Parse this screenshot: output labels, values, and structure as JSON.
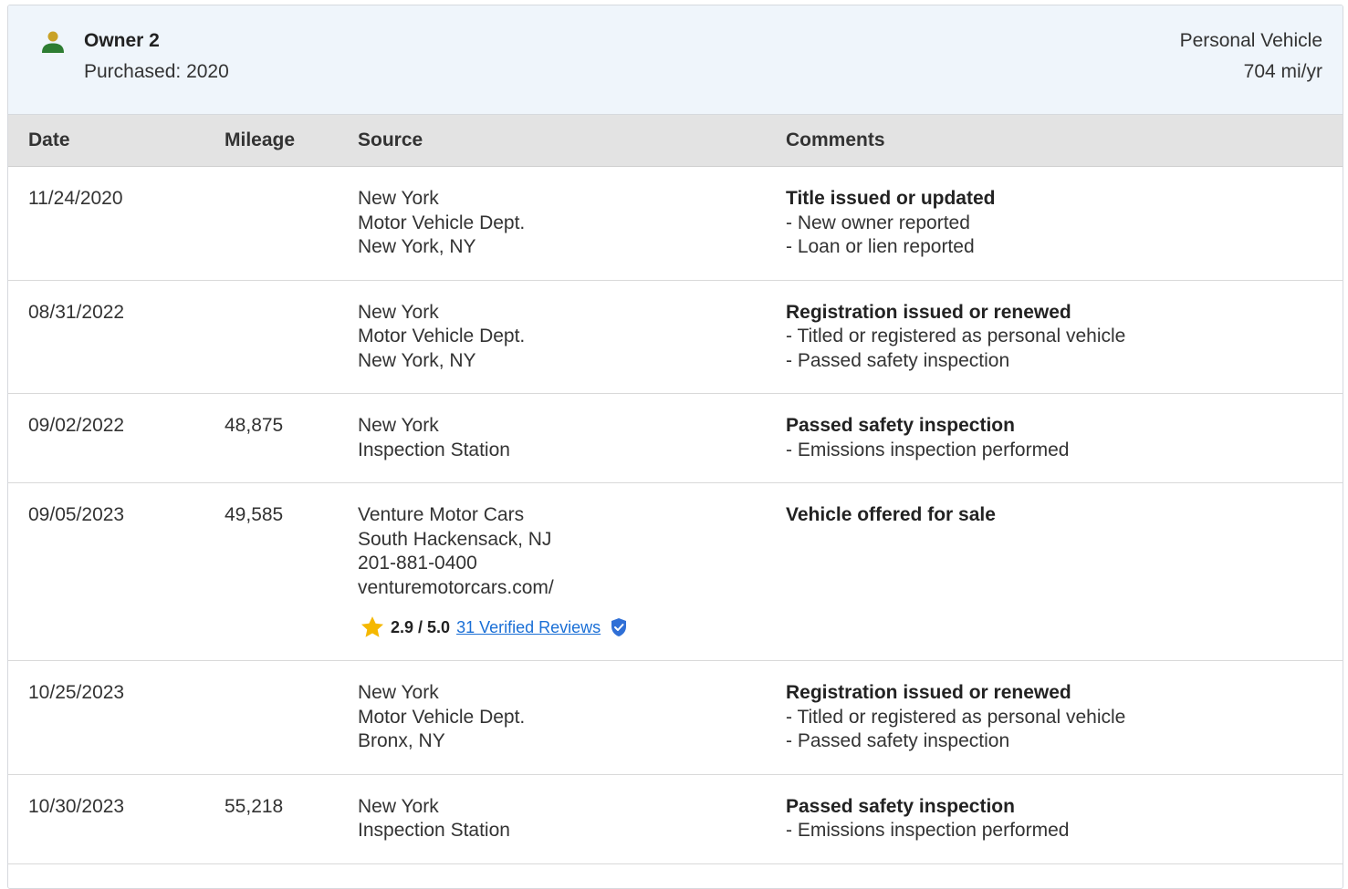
{
  "owner": {
    "title": "Owner 2",
    "purchased": "Purchased: 2020",
    "usage_type": "Personal Vehicle",
    "miles_per_year": "704 mi/yr"
  },
  "table": {
    "headers": {
      "date": "Date",
      "mileage": "Mileage",
      "source": "Source",
      "comments": "Comments"
    },
    "rows": [
      {
        "date": "11/24/2020",
        "mileage": "",
        "source": [
          "New York",
          "Motor Vehicle Dept.",
          "New York, NY"
        ],
        "comment_title": "Title issued or updated",
        "comment_items": [
          "New owner reported",
          "Loan or lien reported"
        ]
      },
      {
        "date": "08/31/2022",
        "mileage": "",
        "source": [
          "New York",
          "Motor Vehicle Dept.",
          "New York, NY"
        ],
        "comment_title": "Registration issued or renewed",
        "comment_items": [
          "Titled or registered as personal vehicle",
          "Passed safety inspection"
        ]
      },
      {
        "date": "09/02/2022",
        "mileage": "48,875",
        "source": [
          "New York",
          "Inspection Station"
        ],
        "comment_title": "Passed safety inspection",
        "comment_items": [
          "Emissions inspection performed"
        ]
      },
      {
        "date": "09/05/2023",
        "mileage": "49,585",
        "source": [
          "Venture Motor Cars",
          "South Hackensack, NJ",
          "201-881-0400",
          "venturemotorcars.com/"
        ],
        "rating": {
          "value": "2.9 / 5.0",
          "reviews_link": "31 Verified Reviews"
        },
        "comment_title": "Vehicle offered for sale",
        "comment_items": []
      },
      {
        "date": "10/25/2023",
        "mileage": "",
        "source": [
          "New York",
          "Motor Vehicle Dept.",
          "Bronx, NY"
        ],
        "comment_title": "Registration issued or renewed",
        "comment_items": [
          "Titled or registered as personal vehicle",
          "Passed safety inspection"
        ]
      },
      {
        "date": "10/30/2023",
        "mileage": "55,218",
        "source": [
          "New York",
          "Inspection Station"
        ],
        "comment_title": "Passed safety inspection",
        "comment_items": [
          "Emissions inspection performed"
        ]
      }
    ]
  },
  "icons": {
    "person": "person-icon",
    "star": "star-icon",
    "verified": "verified-shield-icon"
  },
  "colors": {
    "header_bg": "#eff5fb",
    "table_header_bg": "#e3e3e3",
    "link": "#1a6fd6",
    "star": "#f5b800",
    "person_head": "#c9a227",
    "person_body": "#2e7d32",
    "shield": "#2f6fd6"
  }
}
